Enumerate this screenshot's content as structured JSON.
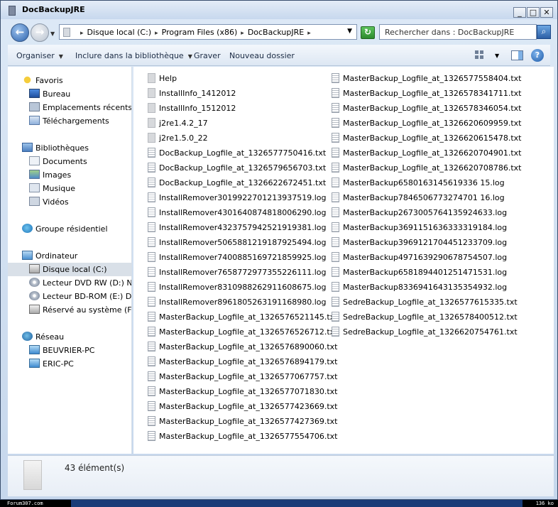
{
  "window": {
    "title": "DocBackupJRE"
  },
  "address": {
    "crumbs": [
      "Disque local (C:)",
      "Program Files (x86)",
      "DocBackupJRE"
    ],
    "search_placeholder": "Rechercher dans : DocBackupJRE"
  },
  "toolbar": {
    "organize": "Organiser",
    "include_library": "Inclure dans la bibliothèque",
    "burn": "Graver",
    "new_folder": "Nouveau dossier"
  },
  "nav": {
    "favorites": "Favoris",
    "desktop": "Bureau",
    "recent": "Emplacements récents",
    "downloads": "Téléchargements",
    "libraries": "Bibliothèques",
    "documents": "Documents",
    "images": "Images",
    "music": "Musique",
    "videos": "Vidéos",
    "homegroup": "Groupe résidentiel",
    "computer": "Ordinateur",
    "local_disk": "Disque local (C:)",
    "dvd": "Lecteur DVD RW (D:) Nouv",
    "bd": "Lecteur BD-ROM (E:) DVD",
    "reserved": "Réservé au système (F:)",
    "network": "Réseau",
    "pc1": "BEUVRIER-PC",
    "pc2": "ERIC-PC"
  },
  "files_col1": [
    {
      "name": "Help",
      "type": "folder"
    },
    {
      "name": "InstallInfo_1412012",
      "type": "folder"
    },
    {
      "name": "InstallInfo_1512012",
      "type": "folder"
    },
    {
      "name": "j2re1.4.2_17",
      "type": "folder"
    },
    {
      "name": "j2re1.5.0_22",
      "type": "folder"
    },
    {
      "name": "DocBackup_Logfile_at_1326577750416.txt",
      "type": "txt"
    },
    {
      "name": "DocBackup_Logfile_at_1326579656703.txt",
      "type": "txt"
    },
    {
      "name": "DocBackup_Logfile_at_1326622672451.txt",
      "type": "txt"
    },
    {
      "name": "InstallRemover3019922701213937519.log",
      "type": "log"
    },
    {
      "name": "InstallRemover4301640874818006290.log",
      "type": "log"
    },
    {
      "name": "InstallRemover4323757942521919381.log",
      "type": "log"
    },
    {
      "name": "InstallRemover5065881219187925494.log",
      "type": "log"
    },
    {
      "name": "InstallRemover7400885169721859925.log",
      "type": "log"
    },
    {
      "name": "InstallRemover7658772977355226111.log",
      "type": "log"
    },
    {
      "name": "InstallRemover8310988262911608675.log",
      "type": "log"
    },
    {
      "name": "InstallRemover8961805263191168980.log",
      "type": "log"
    },
    {
      "name": "MasterBackup_Logfile_at_1326576521145.txt",
      "type": "txt"
    },
    {
      "name": "MasterBackup_Logfile_at_1326576526712.txt",
      "type": "txt"
    },
    {
      "name": "MasterBackup_Logfile_at_1326576890060.txt",
      "type": "txt"
    },
    {
      "name": "MasterBackup_Logfile_at_1326576894179.txt",
      "type": "txt"
    },
    {
      "name": "MasterBackup_Logfile_at_1326577067757.txt",
      "type": "txt"
    },
    {
      "name": "MasterBackup_Logfile_at_1326577071830.txt",
      "type": "txt"
    },
    {
      "name": "MasterBackup_Logfile_at_1326577423669.txt",
      "type": "txt"
    },
    {
      "name": "MasterBackup_Logfile_at_1326577427369.txt",
      "type": "txt"
    },
    {
      "name": "MasterBackup_Logfile_at_1326577554706.txt",
      "type": "txt"
    }
  ],
  "files_col2": [
    {
      "name": "MasterBackup_Logfile_at_1326577558404.txt",
      "type": "txt"
    },
    {
      "name": "MasterBackup_Logfile_at_1326578341711.txt",
      "type": "txt"
    },
    {
      "name": "MasterBackup_Logfile_at_1326578346054.txt",
      "type": "txt"
    },
    {
      "name": "MasterBackup_Logfile_at_1326620609959.txt",
      "type": "txt"
    },
    {
      "name": "MasterBackup_Logfile_at_1326620615478.txt",
      "type": "txt"
    },
    {
      "name": "MasterBackup_Logfile_at_1326620704901.txt",
      "type": "txt"
    },
    {
      "name": "MasterBackup_Logfile_at_1326620708786.txt",
      "type": "txt"
    },
    {
      "name": "MasterBackup6580163145619336 15.log",
      "type": "log"
    },
    {
      "name": "MasterBackup7846506773274701 16.log",
      "type": "log"
    },
    {
      "name": "MasterBackup2673005764135924633.log",
      "type": "log"
    },
    {
      "name": "MasterBackup3691151636333319184.log",
      "type": "log"
    },
    {
      "name": "MasterBackup3969121704451233709.log",
      "type": "log"
    },
    {
      "name": "MasterBackup4971639290678754507.log",
      "type": "log"
    },
    {
      "name": "MasterBackup6581894401251471531.log",
      "type": "log"
    },
    {
      "name": "MasterBackup8336941643135354932.log",
      "type": "log"
    },
    {
      "name": "SedreBackup_Logfile_at_1326577615335.txt",
      "type": "txt"
    },
    {
      "name": "SedreBackup_Logfile_at_1326578400512.txt",
      "type": "txt"
    },
    {
      "name": "SedreBackup_Logfile_at_1326620754761.txt",
      "type": "txt"
    }
  ],
  "details": {
    "count": "43 élément(s)"
  },
  "strip": {
    "left": "Forum307.com",
    "right": "136 ko"
  }
}
